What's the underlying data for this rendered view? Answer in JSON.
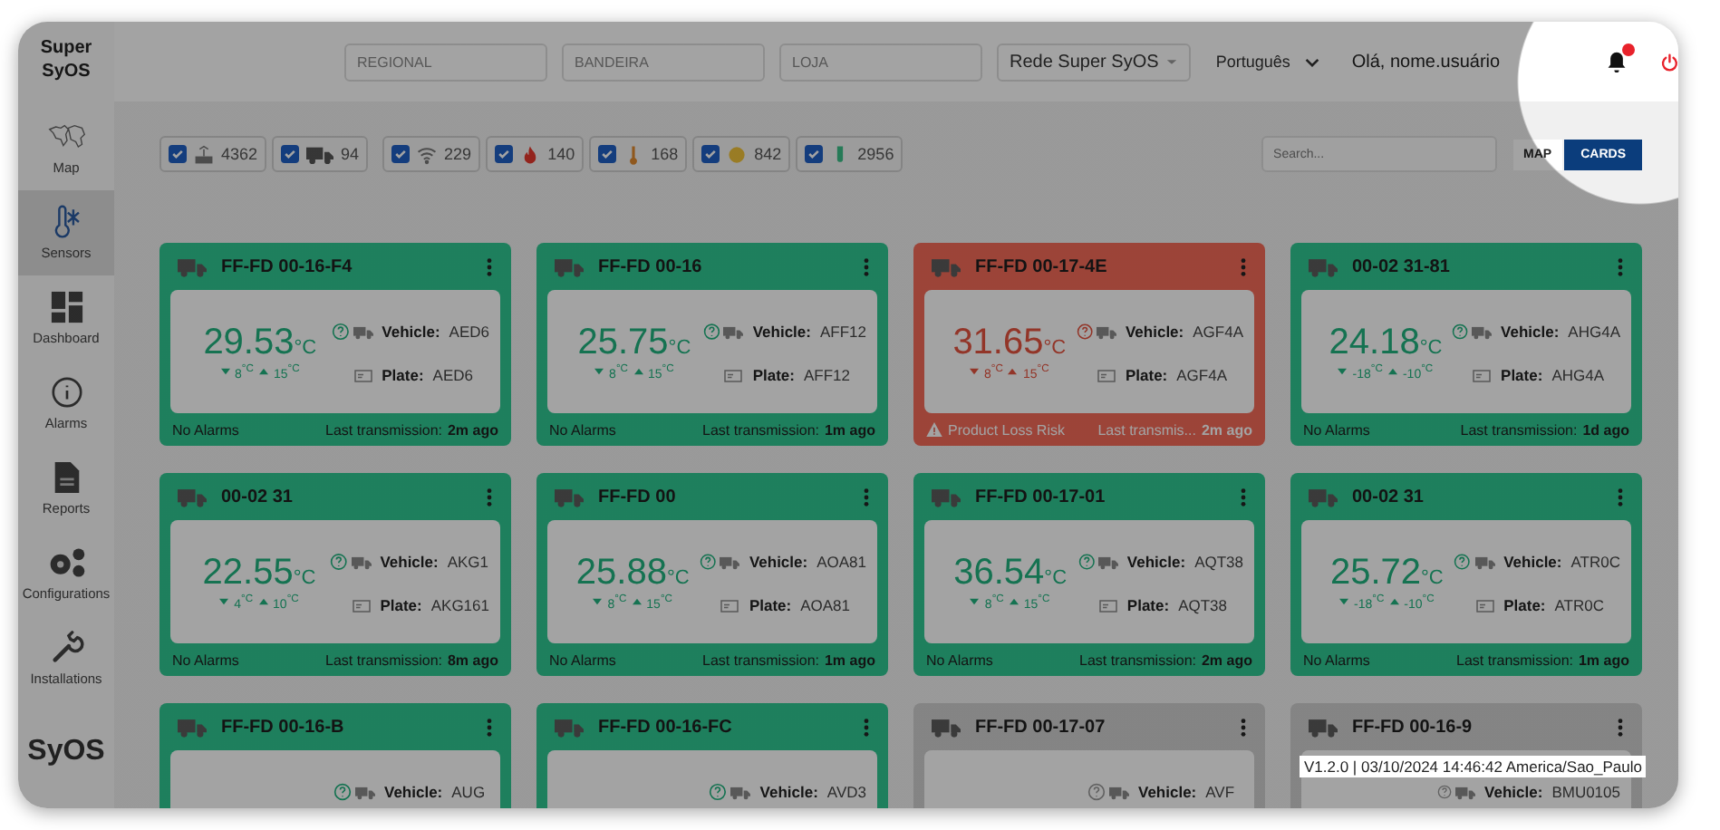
{
  "sidebar": {
    "brand": "Super SyOS",
    "items": [
      {
        "label": "Map",
        "selected": false
      },
      {
        "label": "Sensors",
        "selected": true
      },
      {
        "label": "Dashboard",
        "selected": false
      },
      {
        "label": "Alarms",
        "selected": false
      },
      {
        "label": "Reports",
        "selected": false
      },
      {
        "label": "Configurations",
        "selected": false
      },
      {
        "label": "Installations",
        "selected": false
      }
    ],
    "footer_logo": "SyOS"
  },
  "header": {
    "filters": [
      {
        "placeholder": "REGIONAL"
      },
      {
        "placeholder": "BANDEIRA"
      },
      {
        "placeholder": "LOJA"
      }
    ],
    "network": "Rede Super SyOS",
    "language": "Português",
    "greeting": "Olá, nome.usuário",
    "notifications": {
      "unread": true
    }
  },
  "toolbar": {
    "chip_groups": [
      [
        {
          "kind": "gateway",
          "checked": true,
          "count": "4362"
        },
        {
          "kind": "truck",
          "checked": true,
          "count": "94"
        }
      ],
      [
        {
          "kind": "wifi",
          "checked": true,
          "count": "229"
        },
        {
          "kind": "fire",
          "checked": true,
          "count": "140"
        },
        {
          "kind": "thermo",
          "checked": true,
          "count": "168"
        },
        {
          "kind": "coin",
          "checked": true,
          "count": "842"
        },
        {
          "kind": "probe",
          "checked": true,
          "count": "2956"
        }
      ]
    ],
    "search": {
      "placeholder": "Search..."
    },
    "views": [
      {
        "label": "MAP",
        "selected": false
      },
      {
        "label": "CARDS",
        "selected": true
      }
    ]
  },
  "cards": [
    {
      "name": "FF-FD 00-16-F4",
      "kind": "ok",
      "temperature": "29.53",
      "unit": "°C",
      "min": "8$^{°C}$",
      "max": "15$^{°C}$",
      "vehicle": {
        "label": "Vehicle:",
        "value": "AED6"
      },
      "plate": {
        "label": "Plate:",
        "value": "AED6"
      },
      "alarm": "No Alarms",
      "last_label": "Last transmission:",
      "last_time": "2m ago"
    },
    {
      "name": "FF-FD 00-16",
      "kind": "ok",
      "temperature": "25.75",
      "unit": "°C",
      "min": "8$^{°C}$",
      "max": "15$^{°C}$",
      "vehicle": {
        "label": "Vehicle:",
        "value": "AFF12"
      },
      "plate": {
        "label": "Plate:",
        "value": "AFF12"
      },
      "alarm": "No Alarms",
      "last_label": "Last transmission:",
      "last_time": "1m ago"
    },
    {
      "name": "FF-FD 00-17-4E",
      "kind": "alarm",
      "temperature": "31.65",
      "unit": "°C",
      "min": "8$^{°C}$",
      "max": "15$^{°C}$",
      "vehicle": {
        "label": "Vehicle:",
        "value": "AGF4A"
      },
      "plate": {
        "label": "Plate:",
        "value": "AGF4A"
      },
      "alarm": "Product Loss Risk",
      "last_label": "Last transmis...",
      "last_time": "2m ago"
    },
    {
      "name": "00-02 31-81",
      "kind": "ok",
      "temperature": "24.18",
      "unit": "°C",
      "min": "-18$^{°C}$",
      "max": "-10$^{°C}$",
      "vehicle": {
        "label": "Vehicle:",
        "value": "AHG4A"
      },
      "plate": {
        "label": "Plate:",
        "value": "AHG4A"
      },
      "alarm": "No Alarms",
      "last_label": "Last transmission:",
      "last_time": "1d ago"
    },
    {
      "name": "00-02 31",
      "kind": "ok",
      "temperature": "22.55",
      "unit": "°C",
      "min": "4$^{°C}$",
      "max": "10$^{°C}$",
      "vehicle": {
        "label": "Vehicle:",
        "value": "AKG1"
      },
      "plate": {
        "label": "Plate:",
        "value": "AKG161"
      },
      "alarm": "No Alarms",
      "last_label": "Last transmission:",
      "last_time": "8m ago"
    },
    {
      "name": "FF-FD 00",
      "kind": "ok",
      "temperature": "25.88",
      "unit": "°C",
      "min": "8$^{°C}$",
      "max": "15$^{°C}$",
      "vehicle": {
        "label": "Vehicle:",
        "value": "AOA81"
      },
      "plate": {
        "label": "Plate:",
        "value": "AOA81"
      },
      "alarm": "No Alarms",
      "last_label": "Last transmission:",
      "last_time": "1m ago"
    },
    {
      "name": "FF-FD 00-17-01",
      "kind": "ok",
      "temperature": "36.54",
      "unit": "°C",
      "min": "8$^{°C}$",
      "max": "15$^{°C}$",
      "vehicle": {
        "label": "Vehicle:",
        "value": "AQT38"
      },
      "plate": {
        "label": "Plate:",
        "value": "AQT38"
      },
      "alarm": "No Alarms",
      "last_label": "Last transmission:",
      "last_time": "2m ago"
    },
    {
      "name": "00-02 31",
      "kind": "ok",
      "temperature": "25.72",
      "unit": "°C",
      "min": "-18$^{°C}$",
      "max": "-10$^{°C}$",
      "vehicle": {
        "label": "Vehicle:",
        "value": "ATR0C"
      },
      "plate": {
        "label": "Plate:",
        "value": "ATR0C"
      },
      "alarm": "No Alarms",
      "last_label": "Last transmission:",
      "last_time": "1m ago"
    },
    {
      "name": "FF-FD 00-16-B",
      "kind": "ok",
      "vehicle": {
        "label": "Vehicle:",
        "value": "AUG"
      }
    },
    {
      "name": "FF-FD 00-16-FC",
      "kind": "ok",
      "vehicle": {
        "label": "Vehicle:",
        "value": "AVD3"
      }
    },
    {
      "name": "FF-FD 00-17-07",
      "kind": "offline",
      "vehicle": {
        "label": "Vehicle:",
        "value": "AVF"
      }
    },
    {
      "name": "FF-FD 00-16-9",
      "kind": "offline",
      "vehicle": {
        "label": "Vehicle:",
        "value": "BMU0105"
      }
    }
  ],
  "version_tooltip": "V1.2.0 | 03/10/2024 14:46:42 America/Sao_Paulo"
}
